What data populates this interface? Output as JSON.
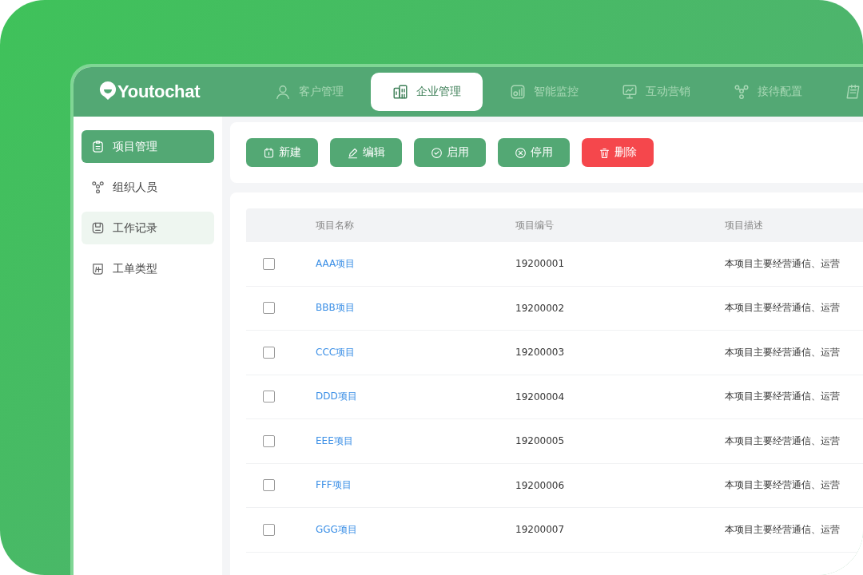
{
  "brand": "Youtochat",
  "tabs": [
    {
      "label": "客户管理",
      "selected": false
    },
    {
      "label": "企业管理",
      "selected": true
    },
    {
      "label": "智能监控",
      "selected": false
    },
    {
      "label": "互动营销",
      "selected": false
    },
    {
      "label": "接待配置",
      "selected": false
    },
    {
      "selected": false
    }
  ],
  "sidebar": {
    "items": [
      {
        "label": "项目管理",
        "selected": true,
        "hovered": false
      },
      {
        "label": "组织人员",
        "selected": false,
        "hovered": false
      },
      {
        "label": "工作记录",
        "selected": false,
        "hovered": true
      },
      {
        "label": "工单类型",
        "selected": false,
        "hovered": false
      }
    ]
  },
  "toolbar": [
    {
      "label": "新建",
      "kind": "primary"
    },
    {
      "label": "编辑",
      "kind": "primary"
    },
    {
      "label": "启用",
      "kind": "primary"
    },
    {
      "label": "停用",
      "kind": "primary"
    },
    {
      "label": "删除",
      "kind": "danger"
    }
  ],
  "table": {
    "columns": [
      "项目名称",
      "项目编号",
      "项目描述"
    ],
    "rows": [
      {
        "checked": false,
        "name": "AAA项目",
        "code": "19200001",
        "description": "本项目主要经营通信、运营"
      },
      {
        "checked": false,
        "name": "BBB项目",
        "code": "19200002",
        "description": "本项目主要经营通信、运营"
      },
      {
        "checked": false,
        "name": "CCC项目",
        "code": "19200003",
        "description": "本项目主要经营通信、运营"
      },
      {
        "checked": false,
        "name": "DDD项目",
        "code": "19200004",
        "description": "本项目主要经营通信、运营"
      },
      {
        "checked": false,
        "name": "EEE项目",
        "code": "19200005",
        "description": "本项目主要经营通信、运营"
      },
      {
        "checked": false,
        "name": "FFF项目",
        "code": "19200006",
        "description": "本项目主要经营通信、运营"
      },
      {
        "checked": false,
        "name": "GGG项目",
        "code": "19200007",
        "description": "本项目主要经营通信、运营"
      }
    ]
  }
}
